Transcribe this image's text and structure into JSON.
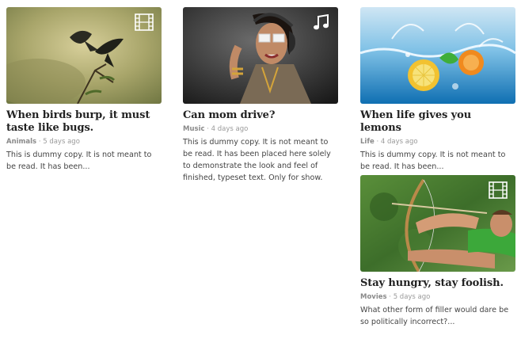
{
  "posts": [
    {
      "title": "When birds burp, it must taste like bugs.",
      "category": "Animals",
      "separator": "·",
      "time": "5 days ago",
      "excerpt": "This is dummy copy. It is not meant to be read. It has been...",
      "media_icon": "film-icon"
    },
    {
      "title": "Can mom drive?",
      "category": "Music",
      "separator": "·",
      "time": "4 days ago",
      "excerpt": "This is dummy copy. It is not meant to be read. It has been placed here solely to demonstrate the look and feel of finished, typeset text. Only for show.",
      "media_icon": "music-note-icon"
    },
    {
      "title": "When life gives you lemons",
      "category": "Life",
      "separator": "·",
      "time": "4 days ago",
      "excerpt": "This is dummy copy. It is not meant to be read. It has been..."
    },
    {
      "title": "Stay hungry, stay foolish.",
      "category": "Movies",
      "separator": "·",
      "time": "5 days ago",
      "excerpt": "What other form of filler would dare be so politically incorrect?...",
      "media_icon": "film-icon"
    }
  ]
}
